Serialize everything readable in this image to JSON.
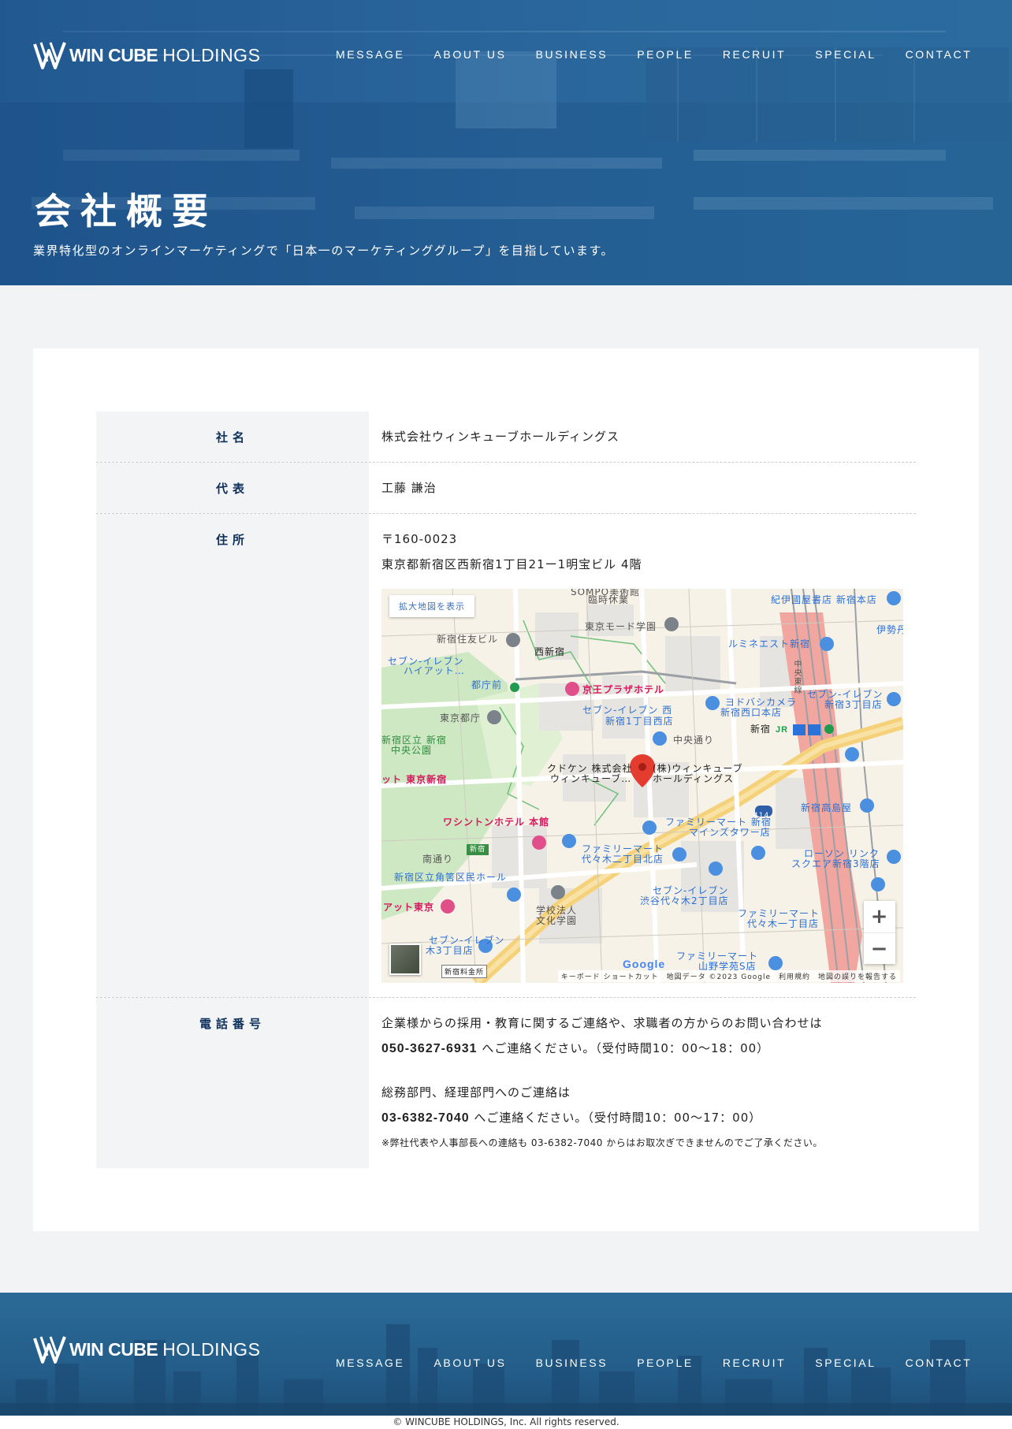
{
  "brand": {
    "bold": "WIN CUBE",
    "light": "HOLDINGS"
  },
  "nav": [
    "MESSAGE",
    "ABOUT US",
    "BUSINESS",
    "PEOPLE",
    "RECRUIT",
    "SPECIAL",
    "CONTACT"
  ],
  "hero": {
    "title": "会社概要",
    "subtitle": "業界特化型のオンラインマーケティングで「日本一のマーケティンググループ」を目指しています。"
  },
  "company": {
    "name_label": "社名",
    "name_value": "株式会社ウィンキューブホールディングス",
    "rep_label": "代表",
    "rep_value": "工藤 謙治",
    "addr_label": "住所",
    "postal": "〒160-0023",
    "address": "東京都新宿区西新宿1丁目21ー1明宝ビル 4階",
    "phone_label": "電話番号",
    "phone_intro1": "企業様からの採用・教育に関するご連絡や、求職者の方からのお問い合わせは",
    "phone1": "050-3627-6931",
    "phone1_suffix": " へご連絡ください。（受付時間10：00～18：00）",
    "phone_intro2": "総務部門、経理部門へのご連絡は",
    "phone2": "03-6382-7040",
    "phone2_suffix": " へご連絡ください。（受付時間10：00～17：00）",
    "phone_note": "※弊社代表や人事部長への連絡も 03-6382-7040 からはお取次ぎできませんのでご了承ください。"
  },
  "map": {
    "enlarge_link": "拡大地図を表示",
    "zoom_in": "+",
    "zoom_out": "−",
    "google": "Google",
    "attribution": "キーボード ショートカット　地図データ ©2023 Google　利用規約　地図の誤りを報告する",
    "badge": "新宿料金所",
    "labels": {
      "l1": "SOMPO美術館",
      "l2": "臨時休業",
      "l3": "紀伊國屋書店 新宿本店",
      "l4": "東京モード学園",
      "l5": "伊勢丹",
      "l6": "新宿住友ビル",
      "l7": "西新宿",
      "l8": "ルミネエスト新宿",
      "l9": "セブン-イレブン",
      "l10": "ハイアット…",
      "l11": "都庁前",
      "l12": "京王プラザホテル",
      "l13": "中央東線",
      "l14": "ヨドバシカメラ",
      "l15": "新宿西口本店",
      "l16": "セブン-イレブン",
      "l17": "新宿3丁目店",
      "l18": "東京都庁",
      "l19": "セブン-イレブン 西",
      "l20": "新宿1丁目西店",
      "l21": "新宿",
      "l22": "中央通り",
      "l23": "新宿区立 新宿",
      "l24": "中央公園",
      "l25": "クドケン 株式会社",
      "l26": "ウィンキューブ…",
      "l27": "(株)ウィンキューブ",
      "l28": "ホールディングス",
      "l29": "ット 東京新宿",
      "l30": "414",
      "l31": "新宿高島屋",
      "l32": "ワシントンホテル 本館",
      "l33": "ファミリーマート 新宿",
      "l34": "マインズタワー店",
      "l35": "新宿",
      "l36": "ファミリーマート",
      "l37": "代々木二丁目北店",
      "l38": "ローソン リンク",
      "l39": "スクエア新宿3階店",
      "l40": "南通り",
      "l41": "新宿区立角筈区民ホール",
      "l42": "セブン-イレブン",
      "l43": "渋谷代々木2丁目店",
      "l44": "アット東京",
      "l45": "学校法人",
      "l46": "文化学園",
      "l47": "ファミリーマート",
      "l48": "代々木一丁目店",
      "l49": "セブン-イレブン",
      "l50": "木3丁目店",
      "l51": "ファミリーマート",
      "l52": "山野学苑S店"
    }
  },
  "copyright": "© WINCUBE HOLDINGS, Inc. All rights reserved."
}
